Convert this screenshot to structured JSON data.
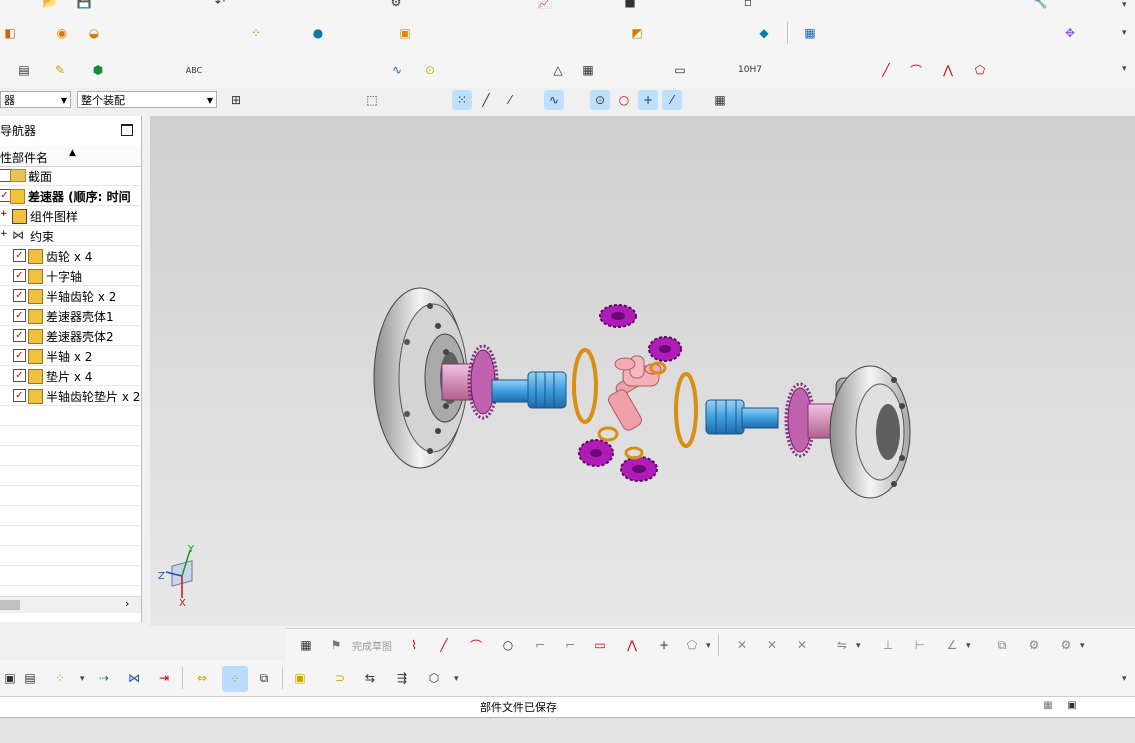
{
  "toolbar": {
    "selection_filter": "器",
    "selection_scope": "整个装配"
  },
  "navigator": {
    "title": "导航器",
    "column_header": "性部件名",
    "items": [
      {
        "label": "截面"
      },
      {
        "label": "差速器 (顺序: 时间"
      },
      {
        "label": "组件图样"
      },
      {
        "label": "约束"
      },
      {
        "label": "齿轮 x 4"
      },
      {
        "label": "十字轴"
      },
      {
        "label": "半轴齿轮 x 2"
      },
      {
        "label": "差速器壳体1"
      },
      {
        "label": "差速器壳体2"
      },
      {
        "label": "半轴 x 2"
      },
      {
        "label": "垫片 x 4"
      },
      {
        "label": "半轴齿轮垫片 x 2"
      }
    ]
  },
  "sketch_toolbar": {
    "finish_sketch": "完成草图"
  },
  "dimension_tool": {
    "label": "10H7"
  },
  "triad": {
    "x": "X",
    "y": "Y",
    "z": "Z"
  },
  "status": {
    "message": "部件文件已保存"
  },
  "colors": {
    "viewport_top": "#cfcfcf",
    "viewport_bottom": "#e8e8e8",
    "housing": "#d8d8d8",
    "half_shaft": "#4aa3df",
    "gear": "#b01cb8",
    "washer": "#d88f12",
    "spider": "#f0a0a8",
    "gear_hub": "#d485b8"
  }
}
